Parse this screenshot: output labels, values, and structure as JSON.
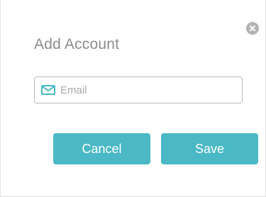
{
  "dialog": {
    "title": "Add Account",
    "email": {
      "value": "",
      "placeholder": "Email"
    },
    "buttons": {
      "cancel_label": "Cancel",
      "save_label": "Save"
    },
    "icons": {
      "close": "close-circle-icon",
      "email": "envelope-icon"
    }
  },
  "colors": {
    "accent": "#4ab8c5",
    "title_text": "#8c8c8c",
    "close_button": "#b3b3b3"
  }
}
